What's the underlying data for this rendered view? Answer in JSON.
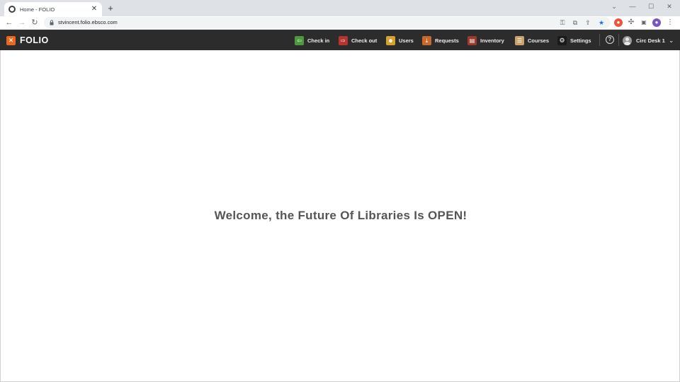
{
  "browser": {
    "tab": {
      "title": "Home - FOLIO",
      "favicon": "folio-tab-icon"
    },
    "url": "stvincent.folio.ebsco.com",
    "window_controls": [
      "minimize",
      "maximize",
      "close"
    ]
  },
  "app": {
    "brand": "FOLIO",
    "brand_color": "#e8681f",
    "nav": [
      {
        "id": "checkin",
        "label": "Check in",
        "icon": "check-in-icon",
        "color": "#4c9a3d"
      },
      {
        "id": "checkout",
        "label": "Check out",
        "icon": "check-out-icon",
        "color": "#b8332d"
      },
      {
        "id": "users",
        "label": "Users",
        "icon": "users-icon",
        "color": "#d7a22b"
      },
      {
        "id": "requests",
        "label": "Requests",
        "icon": "requests-icon",
        "color": "#c8682c"
      },
      {
        "id": "inventory",
        "label": "Inventory",
        "icon": "inventory-icon",
        "color": "#9b3a2a"
      },
      {
        "id": "courses",
        "label": "Courses",
        "icon": "courses-icon",
        "color": "#c9a46a"
      },
      {
        "id": "settings",
        "label": "Settings",
        "icon": "gear-icon",
        "color": "#1a1a1a"
      }
    ],
    "profile_label": "Circ Desk 1"
  },
  "main": {
    "welcome": "Welcome, the Future Of Libraries Is OPEN!"
  }
}
